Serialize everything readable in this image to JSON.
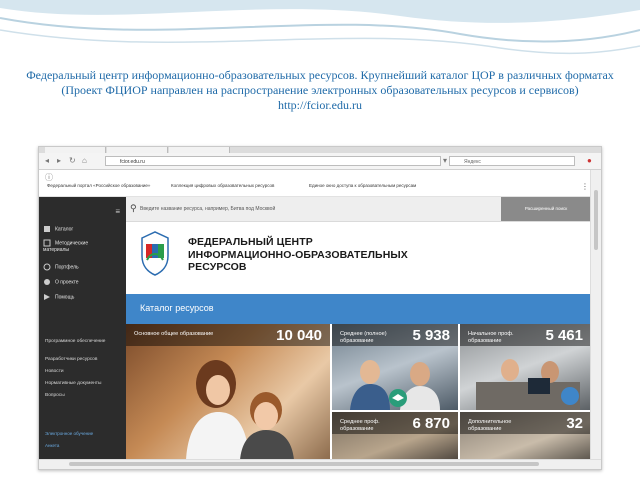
{
  "caption": {
    "line1": "Федеральный центр информационно-образовательных ресурсов. Крупнейший каталог ЦОР в различных форматах",
    "line2": "(Проект ФЦИОР направлен на распространение электронных образовательных ресурсов и сервисов)",
    "url": "http://fcior.edu.ru"
  },
  "browser": {
    "address": "fcior.edu.ru",
    "search_placeholder": "Яндекс",
    "portal_links": [
      "Федеральный портал «Российское образование»",
      "Коллекция цифровых образовательных ресурсов",
      "Единое окно доступа к образовательным ресурсам"
    ]
  },
  "sidebar": {
    "items": [
      {
        "label": "Каталог",
        "icon": "catalog-icon"
      },
      {
        "label": "Методические материалы",
        "icon": "methods-icon"
      },
      {
        "label": "Портфель",
        "icon": "portfolio-icon"
      },
      {
        "label": "О проекте",
        "icon": "info-icon"
      },
      {
        "label": "Помощь",
        "icon": "help-icon"
      }
    ],
    "links": [
      "Программное обеспечение",
      "Разработчики ресурсов",
      "Новости",
      "Нормативные документы",
      "Вопросы"
    ],
    "footer": [
      "Электронное обучение",
      "Анкета"
    ]
  },
  "search": {
    "placeholder": "Введите название ресурса, например, Битва под Москвой",
    "advanced_label": "Расширенный поиск"
  },
  "brand": {
    "title_line1": "ФЕДЕРАЛЬНЫЙ ЦЕНТР",
    "title_line2": "ИНФОРМАЦИОННО-ОБРАЗОВАТЕЛЬНЫХ",
    "title_line3": "РЕСУРСОВ"
  },
  "catalog": {
    "heading": "Каталог ресурсов",
    "tiles": [
      {
        "label": "Основное общее образование",
        "count": "10 040"
      },
      {
        "label": "Среднее (полное) образование",
        "count": "5 938"
      },
      {
        "label": "Начальное проф. образование",
        "count": "5 461"
      },
      {
        "label": "Среднее проф. образование",
        "count": "6 870"
      },
      {
        "label": "Дополнительное образование",
        "count": "32"
      }
    ]
  },
  "colors": {
    "caption": "#1f6aa8",
    "sidebar": "#2c2c2c",
    "catalog_band": "#3f86c9"
  }
}
